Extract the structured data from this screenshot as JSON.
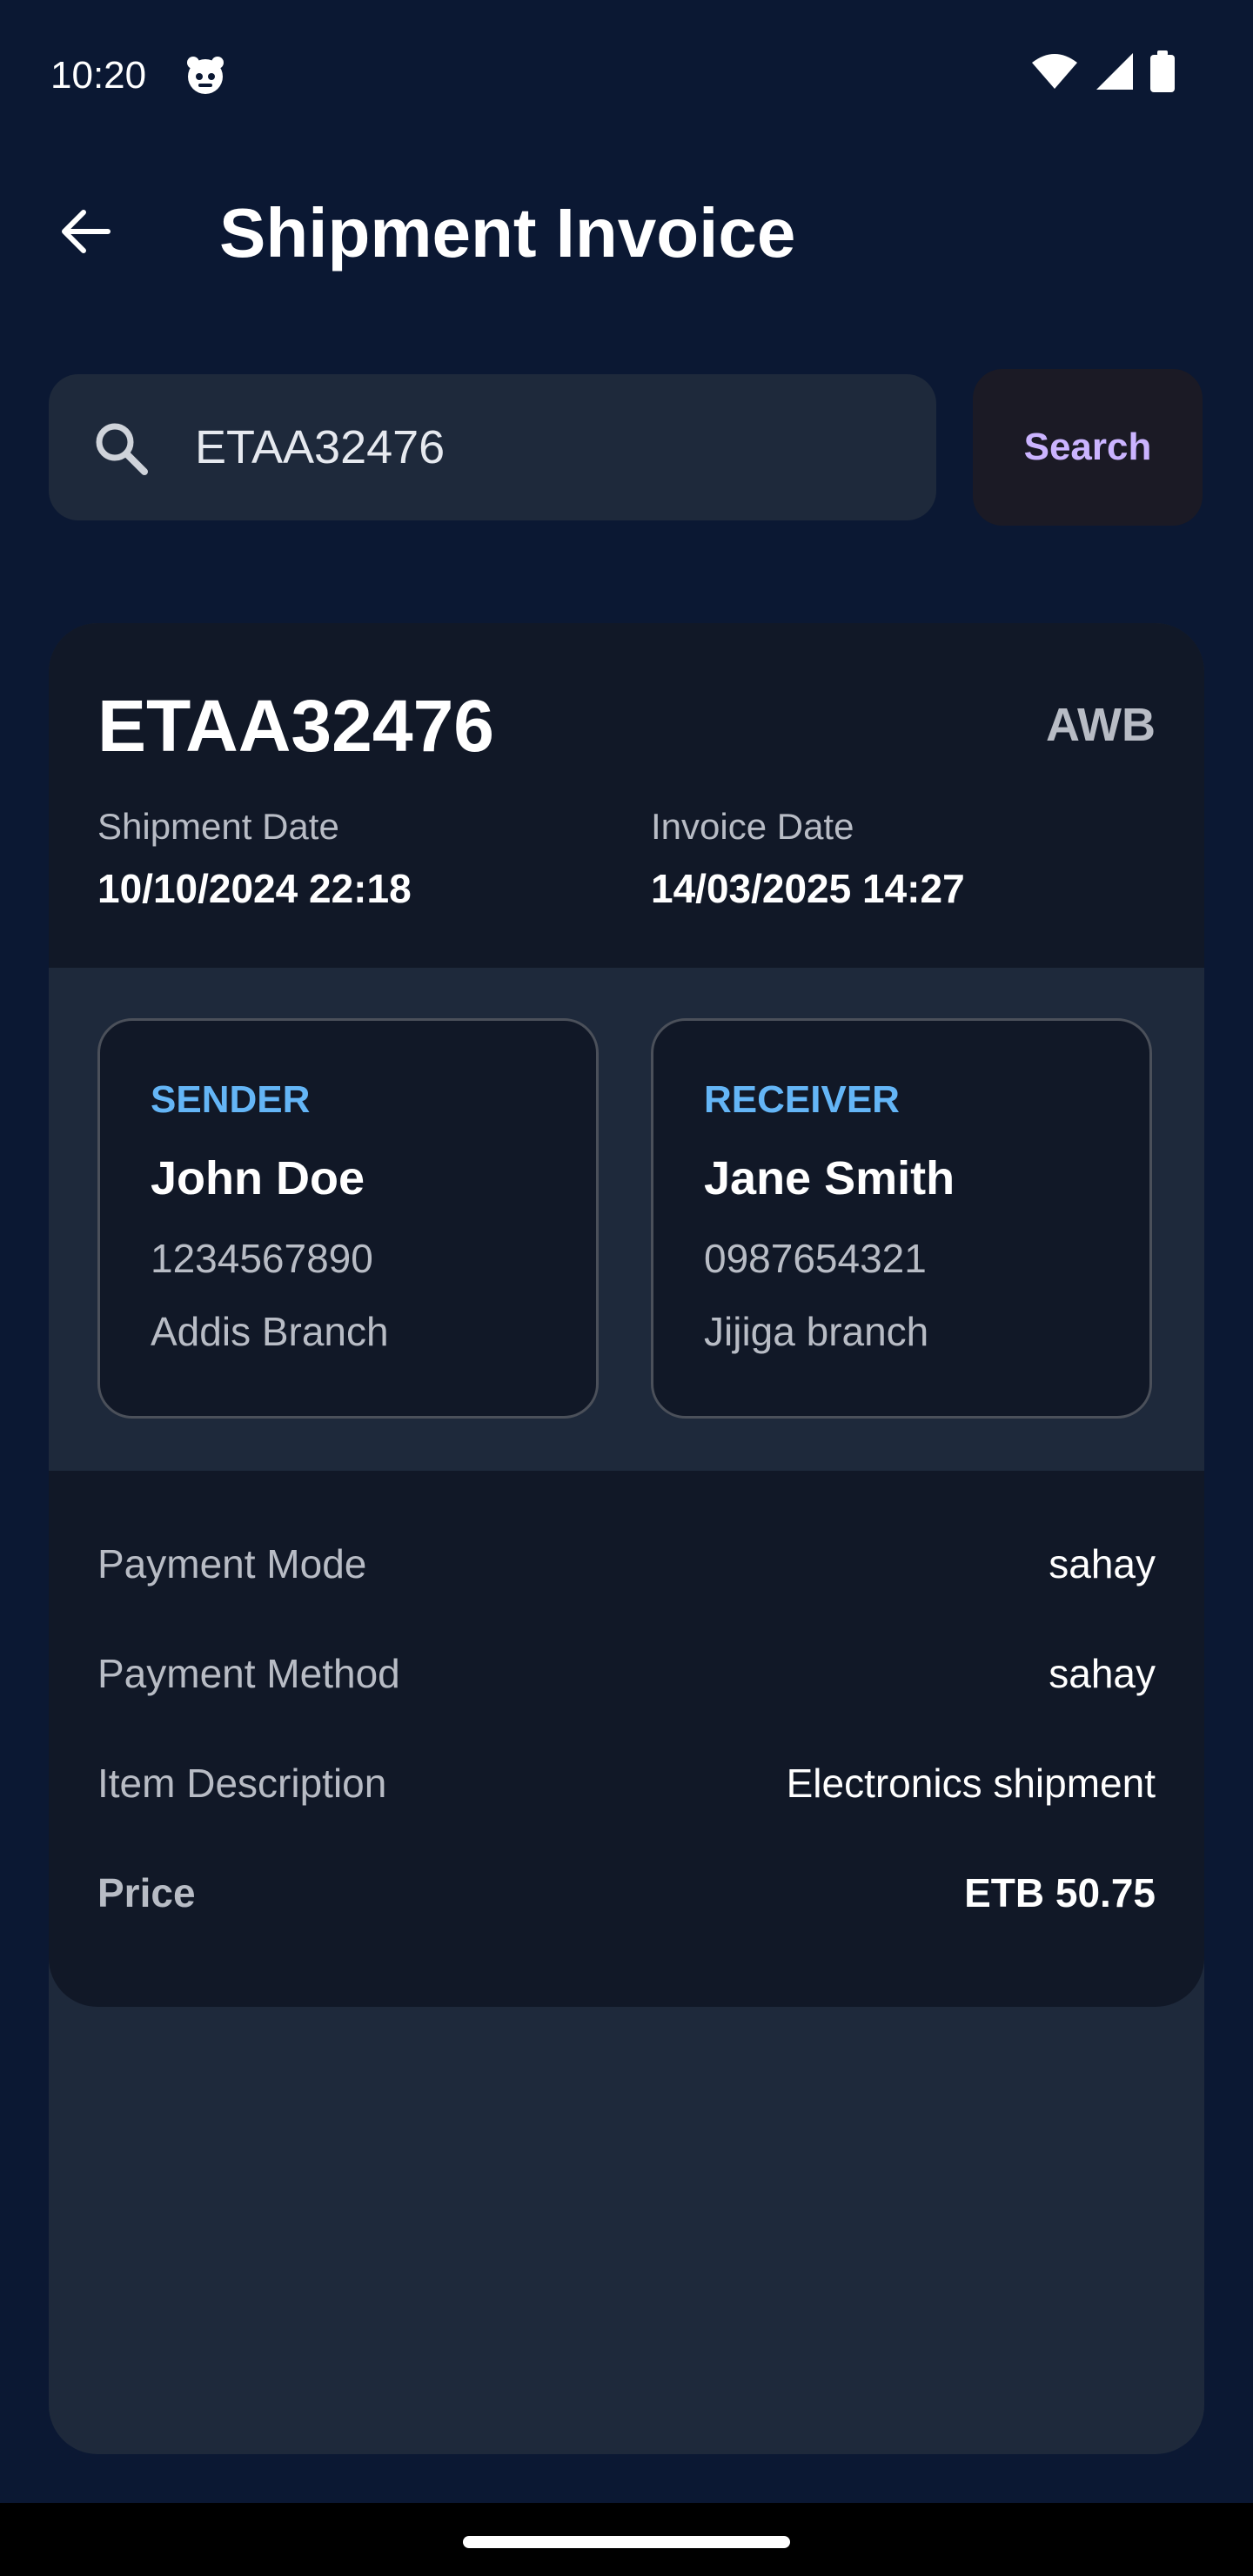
{
  "status_bar": {
    "time": "10:20",
    "app_icon": "face-icon",
    "icons": [
      "wifi-icon",
      "signal-icon",
      "battery-icon"
    ]
  },
  "app_bar": {
    "back_icon": "arrow-left-icon",
    "title": "Shipment Invoice"
  },
  "search": {
    "icon": "search-icon",
    "value": "ETAA32476",
    "button_label": "Search"
  },
  "invoice": {
    "tracking_number": "ETAA32476",
    "type_label": "AWB",
    "shipment_date_label": "Shipment Date",
    "shipment_date": "10/10/2024 22:18",
    "invoice_date_label": "Invoice Date",
    "invoice_date": "14/03/2025 14:27",
    "sender": {
      "role": "SENDER",
      "name": "John Doe",
      "phone": "1234567890",
      "branch": "Addis Branch"
    },
    "receiver": {
      "role": "RECEIVER",
      "name": "Jane Smith",
      "phone": "0987654321",
      "branch": "Jijiga branch"
    },
    "details": [
      {
        "label": "Payment Mode",
        "value": "sahay"
      },
      {
        "label": "Payment Method",
        "value": "sahay"
      },
      {
        "label": "Item Description",
        "value": "Electronics shipment"
      },
      {
        "label": "Price",
        "value": "ETB 50.75"
      }
    ]
  },
  "colors": {
    "background": "#0b1833",
    "card": "#111827",
    "card_alt": "#1e293b",
    "accent_blue": "#64b5f6",
    "search_button_text": "#cbb4ff"
  }
}
